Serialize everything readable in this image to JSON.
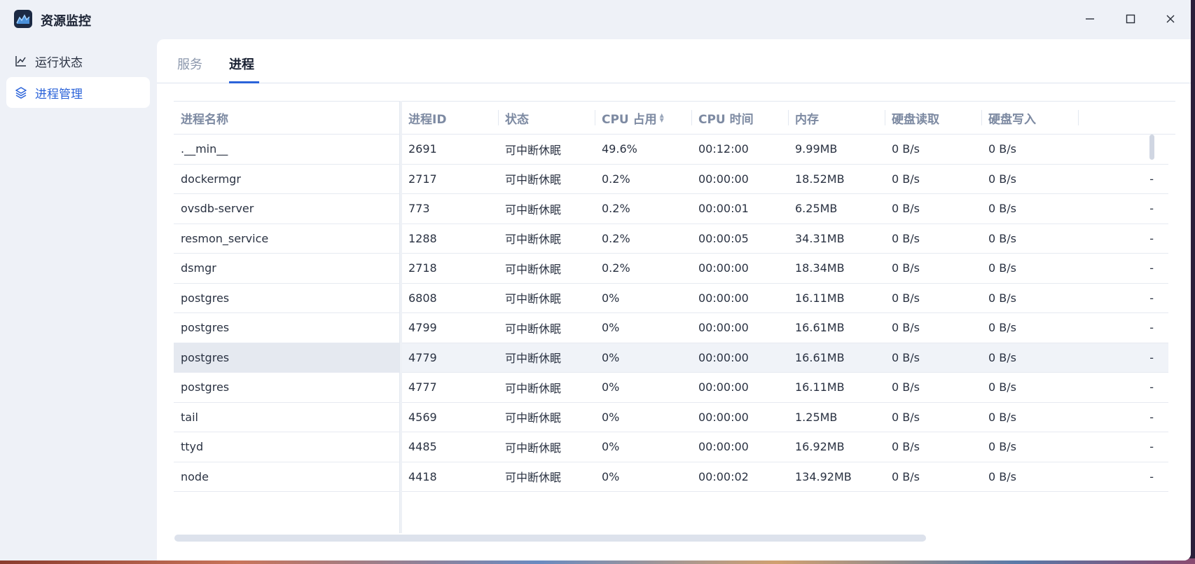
{
  "app": {
    "title": "资源监控",
    "icon": "monitor-chart-icon"
  },
  "window_controls": {
    "minimize": "—",
    "maximize": "☐",
    "close": "✕"
  },
  "sidebar": {
    "items": [
      {
        "label": "运行状态",
        "icon": "line-chart-icon",
        "active": false
      },
      {
        "label": "进程管理",
        "icon": "layers-icon",
        "active": true
      }
    ]
  },
  "tabs": [
    {
      "label": "服务",
      "active": false
    },
    {
      "label": "进程",
      "active": true
    }
  ],
  "table": {
    "columns": [
      "进程名称",
      "进程ID",
      "状态",
      "CPU 占用",
      "CPU 时间",
      "内存",
      "硬盘读取",
      "硬盘写入"
    ],
    "sorted_column": "CPU 占用",
    "rows": [
      {
        "name": ".__min__",
        "pid": "2691",
        "status": "可中断休眠",
        "cpu": "49.6%",
        "cpu_time": "00:12:00",
        "mem": "9.99MB",
        "read": "0 B/s",
        "write": "0 B/s",
        "extra": "-"
      },
      {
        "name": "dockermgr",
        "pid": "2717",
        "status": "可中断休眠",
        "cpu": "0.2%",
        "cpu_time": "00:00:00",
        "mem": "18.52MB",
        "read": "0 B/s",
        "write": "0 B/s",
        "extra": "-"
      },
      {
        "name": "ovsdb-server",
        "pid": "773",
        "status": "可中断休眠",
        "cpu": "0.2%",
        "cpu_time": "00:00:01",
        "mem": "6.25MB",
        "read": "0 B/s",
        "write": "0 B/s",
        "extra": "-"
      },
      {
        "name": "resmon_service",
        "pid": "1288",
        "status": "可中断休眠",
        "cpu": "0.2%",
        "cpu_time": "00:00:05",
        "mem": "34.31MB",
        "read": "0 B/s",
        "write": "0 B/s",
        "extra": "-"
      },
      {
        "name": "dsmgr",
        "pid": "2718",
        "status": "可中断休眠",
        "cpu": "0.2%",
        "cpu_time": "00:00:00",
        "mem": "18.34MB",
        "read": "0 B/s",
        "write": "0 B/s",
        "extra": "-"
      },
      {
        "name": "postgres",
        "pid": "6808",
        "status": "可中断休眠",
        "cpu": "0%",
        "cpu_time": "00:00:00",
        "mem": "16.11MB",
        "read": "0 B/s",
        "write": "0 B/s",
        "extra": "-"
      },
      {
        "name": "postgres",
        "pid": "4799",
        "status": "可中断休眠",
        "cpu": "0%",
        "cpu_time": "00:00:00",
        "mem": "16.61MB",
        "read": "0 B/s",
        "write": "0 B/s",
        "extra": "-"
      },
      {
        "name": "postgres",
        "pid": "4779",
        "status": "可中断休眠",
        "cpu": "0%",
        "cpu_time": "00:00:00",
        "mem": "16.61MB",
        "read": "0 B/s",
        "write": "0 B/s",
        "extra": "-",
        "hover": true
      },
      {
        "name": "postgres",
        "pid": "4777",
        "status": "可中断休眠",
        "cpu": "0%",
        "cpu_time": "00:00:00",
        "mem": "16.11MB",
        "read": "0 B/s",
        "write": "0 B/s",
        "extra": "-"
      },
      {
        "name": "tail",
        "pid": "4569",
        "status": "可中断休眠",
        "cpu": "0%",
        "cpu_time": "00:00:00",
        "mem": "1.25MB",
        "read": "0 B/s",
        "write": "0 B/s",
        "extra": "-"
      },
      {
        "name": "ttyd",
        "pid": "4485",
        "status": "可中断休眠",
        "cpu": "0%",
        "cpu_time": "00:00:00",
        "mem": "16.92MB",
        "read": "0 B/s",
        "write": "0 B/s",
        "extra": "-"
      },
      {
        "name": "node",
        "pid": "4418",
        "status": "可中断休眠",
        "cpu": "0%",
        "cpu_time": "00:00:02",
        "mem": "134.92MB",
        "read": "0 B/s",
        "write": "0 B/s",
        "extra": "-"
      }
    ]
  },
  "colors": {
    "accent": "#2b63d9",
    "header_text": "#7d8aa2",
    "body_text": "#2a3242"
  }
}
